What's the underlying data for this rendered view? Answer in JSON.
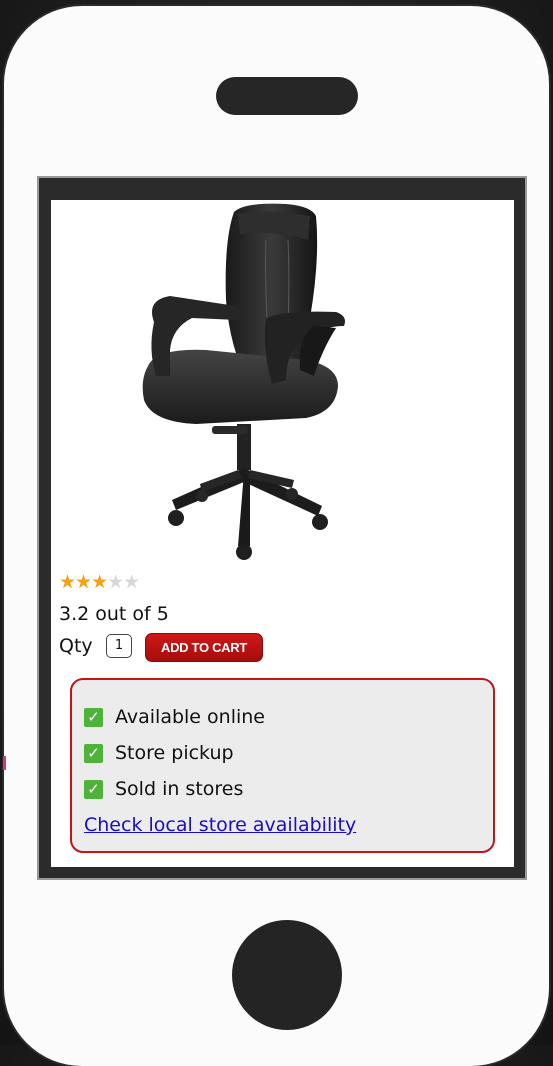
{
  "product": {
    "image_alt": "black leather office chair",
    "rating_stars": "★★★",
    "rating_stars_empty": "★★",
    "rating_value": 3.2,
    "rating_max": 5,
    "rating_text": "3.2 out of 5"
  },
  "purchase": {
    "qty_label": "Qty",
    "qty_value": "1",
    "add_to_cart_label": "ADD TO CART"
  },
  "availability": {
    "items": [
      {
        "check": "✓",
        "label": "Available online"
      },
      {
        "check": "✓",
        "label": "Store pickup"
      },
      {
        "check": "✓",
        "label": "Sold in stores"
      }
    ],
    "link_label": "Check local store availability"
  },
  "colors": {
    "accent_red": "#c1141c",
    "star": "#f4a11a",
    "check_green": "#4fb33b",
    "link_blue": "#1a0dcc"
  }
}
